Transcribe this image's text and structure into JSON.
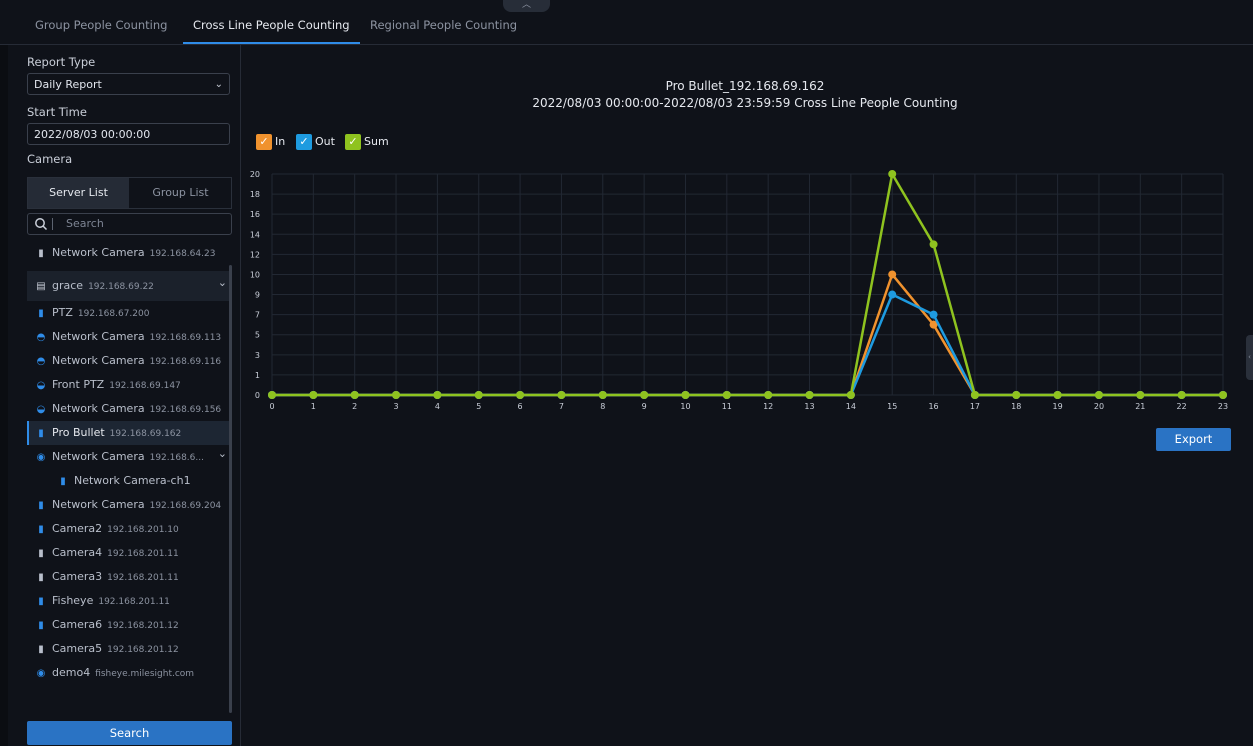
{
  "tabs": [
    "Group People Counting",
    "Cross Line People Counting",
    "Regional People Counting"
  ],
  "active_tab_index": 1,
  "form": {
    "report_type_label": "Report Type",
    "report_type_value": "Daily Report",
    "start_time_label": "Start Time",
    "start_time_value": "2022/08/03 00:00:00",
    "camera_label": "Camera",
    "server_list": "Server List",
    "group_list": "Group List",
    "search_placeholder": "Search",
    "search_button": "Search"
  },
  "tree": [
    {
      "name": "Network Camera",
      "ip": "192.168.64.23",
      "icon": "bullet-camera-icon"
    },
    {
      "name": "grace",
      "ip": "192.168.69.22",
      "icon": "server-icon",
      "group": true
    },
    {
      "name": "PTZ",
      "ip": "192.168.67.200",
      "icon": "bullet-camera-icon"
    },
    {
      "name": "Network Camera",
      "ip": "192.168.69.113",
      "icon": "dome-camera-icon"
    },
    {
      "name": "Network Camera",
      "ip": "192.168.69.116",
      "icon": "dome-camera-icon"
    },
    {
      "name": "Front PTZ",
      "ip": "192.168.69.147",
      "icon": "ptz-camera-icon"
    },
    {
      "name": "Network Camera",
      "ip": "192.168.69.156",
      "icon": "ptz-camera-icon"
    },
    {
      "name": "Pro Bullet",
      "ip": "192.168.69.162",
      "icon": "bullet-camera-icon",
      "selected": true
    },
    {
      "name": "Network Camera",
      "ip": "192.168.6...",
      "icon": "fisheye-camera-icon",
      "expandable": true
    },
    {
      "name": "Network Camera-ch1",
      "ip": "",
      "icon": "bullet-camera-icon",
      "child": true
    },
    {
      "name": "Network Camera",
      "ip": "192.168.69.204",
      "icon": "bullet-camera-icon"
    },
    {
      "name": "Camera2",
      "ip": "192.168.201.10",
      "icon": "bullet-camera-icon"
    },
    {
      "name": "Camera4",
      "ip": "192.168.201.11",
      "icon": "bullet-camera-icon"
    },
    {
      "name": "Camera3",
      "ip": "192.168.201.11",
      "icon": "bullet-camera-icon"
    },
    {
      "name": "Fisheye",
      "ip": "192.168.201.11",
      "icon": "bullet-camera-icon"
    },
    {
      "name": "Camera6",
      "ip": "192.168.201.12",
      "icon": "bullet-camera-icon"
    },
    {
      "name": "Camera5",
      "ip": "192.168.201.12",
      "icon": "bullet-camera-icon"
    },
    {
      "name": "demo4",
      "ip": "fisheye.milesight.com",
      "icon": "fisheye-camera-icon"
    }
  ],
  "report": {
    "camera_title": "Pro Bullet_192.168.69.162",
    "range_title": "2022/08/03 00:00:00-2022/08/03 23:59:59 Cross Line People Counting",
    "export_button": "Export"
  },
  "colors": {
    "in": "#f0922e",
    "out": "#1e9be0",
    "sum": "#8fc31f",
    "accent": "#2a73c4"
  },
  "chart_data": {
    "type": "line",
    "x": [
      0,
      1,
      2,
      3,
      4,
      5,
      6,
      7,
      8,
      9,
      10,
      11,
      12,
      13,
      14,
      15,
      16,
      17,
      18,
      19,
      20,
      21,
      22,
      23
    ],
    "y_ticks": [
      0,
      1,
      3,
      5,
      7,
      9,
      10,
      12,
      14,
      16,
      18,
      20
    ],
    "ylim": [
      0,
      20
    ],
    "grid": true,
    "legend_position": "top-left",
    "series": [
      {
        "name": "In",
        "color": "#f0922e",
        "values": [
          0,
          0,
          0,
          0,
          0,
          0,
          0,
          0,
          0,
          0,
          0,
          0,
          0,
          0,
          0,
          10,
          6,
          0,
          0,
          0,
          0,
          0,
          0,
          0
        ]
      },
      {
        "name": "Out",
        "color": "#1e9be0",
        "values": [
          0,
          0,
          0,
          0,
          0,
          0,
          0,
          0,
          0,
          0,
          0,
          0,
          0,
          0,
          0,
          9,
          7,
          0,
          0,
          0,
          0,
          0,
          0,
          0
        ]
      },
      {
        "name": "Sum",
        "color": "#8fc31f",
        "values": [
          0,
          0,
          0,
          0,
          0,
          0,
          0,
          0,
          0,
          0,
          0,
          0,
          0,
          0,
          0,
          20,
          13,
          0,
          0,
          0,
          0,
          0,
          0,
          0
        ]
      }
    ]
  }
}
